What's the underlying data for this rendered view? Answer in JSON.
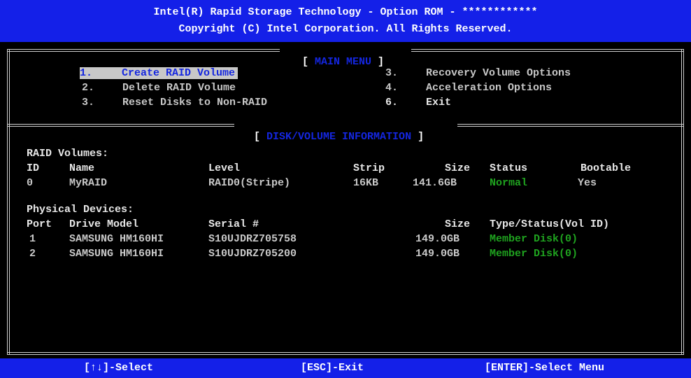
{
  "header": {
    "line1": "Intel(R) Rapid Storage Technology - Option ROM - ************",
    "line2": "Copyright (C) Intel Corporation. All Rights Reserved."
  },
  "main_menu": {
    "title": "MAIN MENU",
    "items": [
      {
        "num": "1.",
        "label": "Create RAID Volume"
      },
      {
        "num": "2.",
        "label": "Delete RAID Volume"
      },
      {
        "num": "3.",
        "label": "Reset Disks to Non-RAID"
      },
      {
        "num": "3.",
        "label": "Recovery Volume Options"
      },
      {
        "num": "4.",
        "label": "Acceleration Options"
      },
      {
        "num": "6.",
        "label": "Exit"
      }
    ]
  },
  "disk_info": {
    "title": "DISK/VOLUME INFORMATION",
    "raid_volumes_label": "RAID Volumes:",
    "volume_headers": {
      "id": "ID",
      "name": "Name",
      "level": "Level",
      "strip": "Strip",
      "size": "Size",
      "status": "Status",
      "bootable": "Bootable"
    },
    "volumes": [
      {
        "id": "0",
        "name": "MyRAID",
        "level": "RAID0(Stripe)",
        "strip": "16KB",
        "size": "141.6GB",
        "status": "Normal",
        "bootable": "Yes"
      }
    ],
    "physical_label": "Physical Devices:",
    "device_headers": {
      "port": "Port",
      "model": "Drive Model",
      "serial": "Serial #",
      "size": "Size",
      "type": "Type/Status(Vol ID)"
    },
    "devices": [
      {
        "port": "1",
        "model": "SAMSUNG HM160HI",
        "serial": "S10UJDRZ705758",
        "size": "149.0GB",
        "type": "Member Disk(0)"
      },
      {
        "port": "2",
        "model": "SAMSUNG HM160HI",
        "serial": "S10UJDRZ705200",
        "size": "149.0GB",
        "type": "Member Disk(0)"
      }
    ]
  },
  "footer": {
    "select": "[↑↓]-Select",
    "exit": "[ESC]-Exit",
    "enter": "[ENTER]-Select Menu"
  },
  "colors": {
    "header_bg": "#1420e8",
    "selected_bg": "#c8c8c8",
    "status_green": "#1fa31f"
  }
}
